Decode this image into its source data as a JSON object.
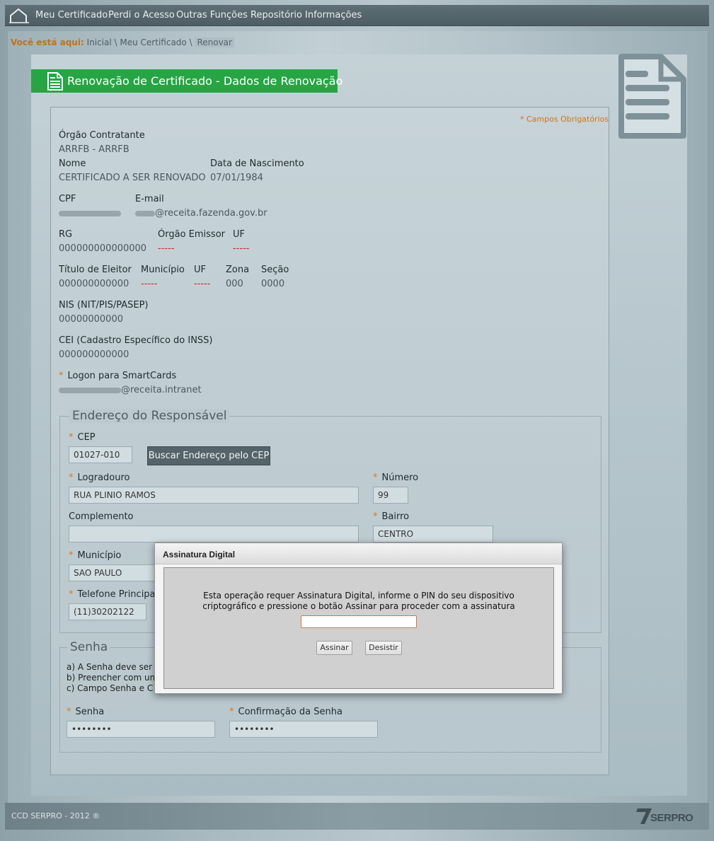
{
  "nav": {
    "items": [
      "Meu Certificado",
      "Perdi o Acesso",
      "Outras Funções",
      "Repositório",
      "Informações"
    ]
  },
  "breadcrumb": {
    "label": "Você está aqui:",
    "items": [
      "Inicial",
      "Meu Certificado",
      "Renovar"
    ],
    "separator": "\\"
  },
  "page": {
    "title": "Renovação de Certificado - Dados de Renovação",
    "required_note": "* Campos Obrigatórios"
  },
  "fields": {
    "orgao_contratante": {
      "label": "Órgão Contratante",
      "value": "ARRFB - ARRFB"
    },
    "nome": {
      "label": "Nome",
      "value": "CERTIFICADO A SER RENOVADO"
    },
    "data_nascimento": {
      "label": "Data de Nascimento",
      "value": "07/01/1984"
    },
    "cpf": {
      "label": "CPF"
    },
    "email": {
      "label": "E-mail",
      "value": "@receita.fazenda.gov.br"
    },
    "rg": {
      "label": "RG",
      "value": "000000000000000"
    },
    "orgao_emissor": {
      "label": "Órgão Emissor",
      "value": "-----"
    },
    "uf_rg": {
      "label": "UF",
      "value": "-----"
    },
    "titulo_eleitor": {
      "label": "Título de Eleitor",
      "value": "000000000000"
    },
    "municipio_eleitor": {
      "label": "Município",
      "value": "-----"
    },
    "uf_eleitor": {
      "label": "UF",
      "value": "-----"
    },
    "zona": {
      "label": "Zona",
      "value": "000"
    },
    "secao": {
      "label": "Seção",
      "value": "0000"
    },
    "nis": {
      "label": "NIS (NIT/PIS/PASEP)",
      "value": "00000000000"
    },
    "cei": {
      "label": "CEI (Cadastro Específico do INSS)",
      "value": "000000000000"
    },
    "logon": {
      "label": "Logon para SmartCards",
      "value": "@receita.intranet"
    }
  },
  "endereco": {
    "legend": "Endereço do Responsável",
    "cep": {
      "label": "CEP",
      "value": "01027-010"
    },
    "buscar_button": "Buscar Endereço pelo CEP",
    "logradouro": {
      "label": "Logradouro",
      "value": "RUA PLINIO RAMOS"
    },
    "numero": {
      "label": "Número",
      "value": "99"
    },
    "complemento": {
      "label": "Complemento",
      "value": ""
    },
    "bairro": {
      "label": "Bairro",
      "value": "CENTRO"
    },
    "municipio": {
      "label": "Município",
      "value": "SAO PAULO"
    },
    "telefone": {
      "label": "Telefone Principal",
      "value": "(11)30202122"
    }
  },
  "senha": {
    "legend": "Senha",
    "rules": [
      "a) A Senha deve ser",
      "b) Preencher com un",
      "c) Campo Senha e C"
    ],
    "senha": {
      "label": "Senha",
      "value": "••••••••"
    },
    "confirmacao": {
      "label": "Confirmação da Senha",
      "value": "••••••••"
    }
  },
  "modal": {
    "title": "Assinatura Digital",
    "message_line1": "Esta operação requer Assinatura Digital, informe o PIN do seu dispositivo",
    "message_line2": "criptográfico e pressione o botão Assinar para proceder com a assinatura",
    "pin_value": "",
    "sign_button": "Assinar",
    "cancel_button": "Desistir"
  },
  "footer": {
    "copyright": "CCD SERPRO - 2012 ®",
    "logo_text": "SERPRO"
  },
  "colors": {
    "title_green": "#27a545",
    "required_orange": "#e0761e",
    "nav_bg": "#55646b"
  }
}
